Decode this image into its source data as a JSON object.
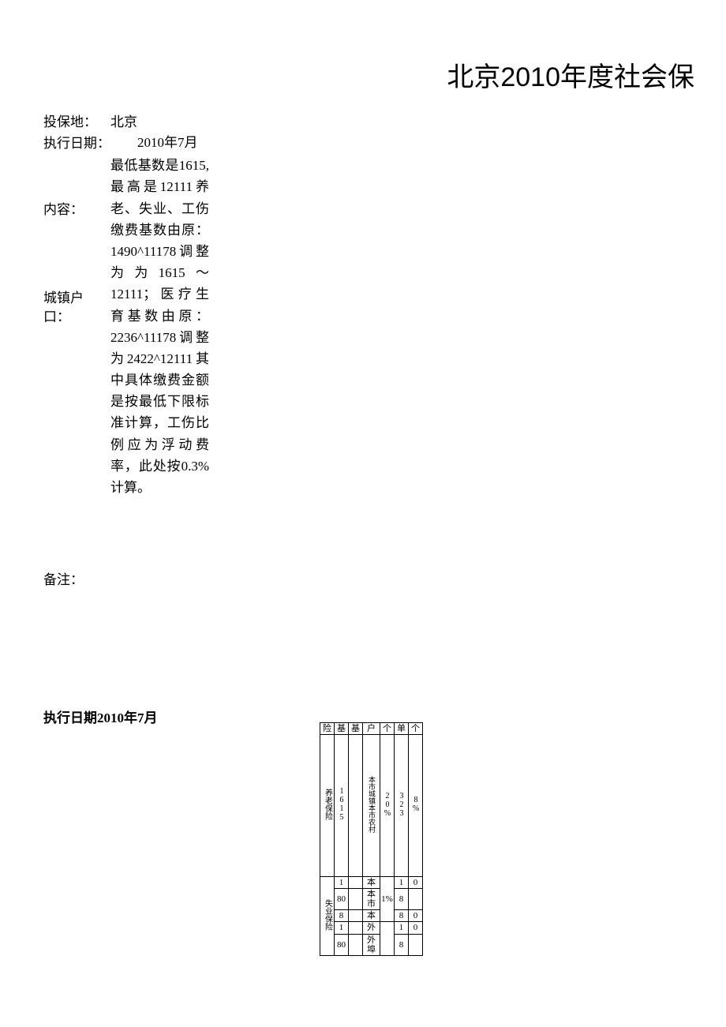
{
  "title": "北京2010年度社会保",
  "labels": {
    "location": "投保地：",
    "exec_date": "执行日期：",
    "content": "内容：",
    "urban": "城镇户口：",
    "remark": "备注：",
    "exec_date_full": "执行日期2010年7月"
  },
  "values": {
    "location": "北京",
    "exec_date": "2010年7月",
    "content_p1": "最低基数是1615,最高是12111养老、失业、工伤缴费基数由原：1490^11178调整为为1615～12111；医疗生育基数由原：2236^11178调整为2422^12111其中具体缴费金额是按最低下限标准计算，工伤比例应为浮动费率，此处按0.3%计算。"
  },
  "table": {
    "header": [
      "险",
      "基",
      "基",
      "户",
      "个",
      "单",
      "个"
    ],
    "rows": [
      {
        "name": "养老保险",
        "base": "1615",
        "col3": "",
        "hukou": "本市城镇本市农村",
        "rate": "20%",
        "amt": "323",
        "p2": "8%"
      }
    ],
    "unemp": {
      "name": "失业保险",
      "r1": [
        "1",
        "",
        "本",
        "",
        "1",
        "0"
      ],
      "r2": [
        "80",
        "",
        "本市",
        "",
        "8",
        ""
      ],
      "r3": [
        "8",
        "",
        "本",
        "1%",
        "8",
        "0"
      ],
      "r4": [
        "1",
        "",
        "外",
        "",
        "1",
        "0"
      ],
      "r5": [
        "80",
        "",
        "外埠",
        "",
        "8",
        ""
      ]
    }
  }
}
